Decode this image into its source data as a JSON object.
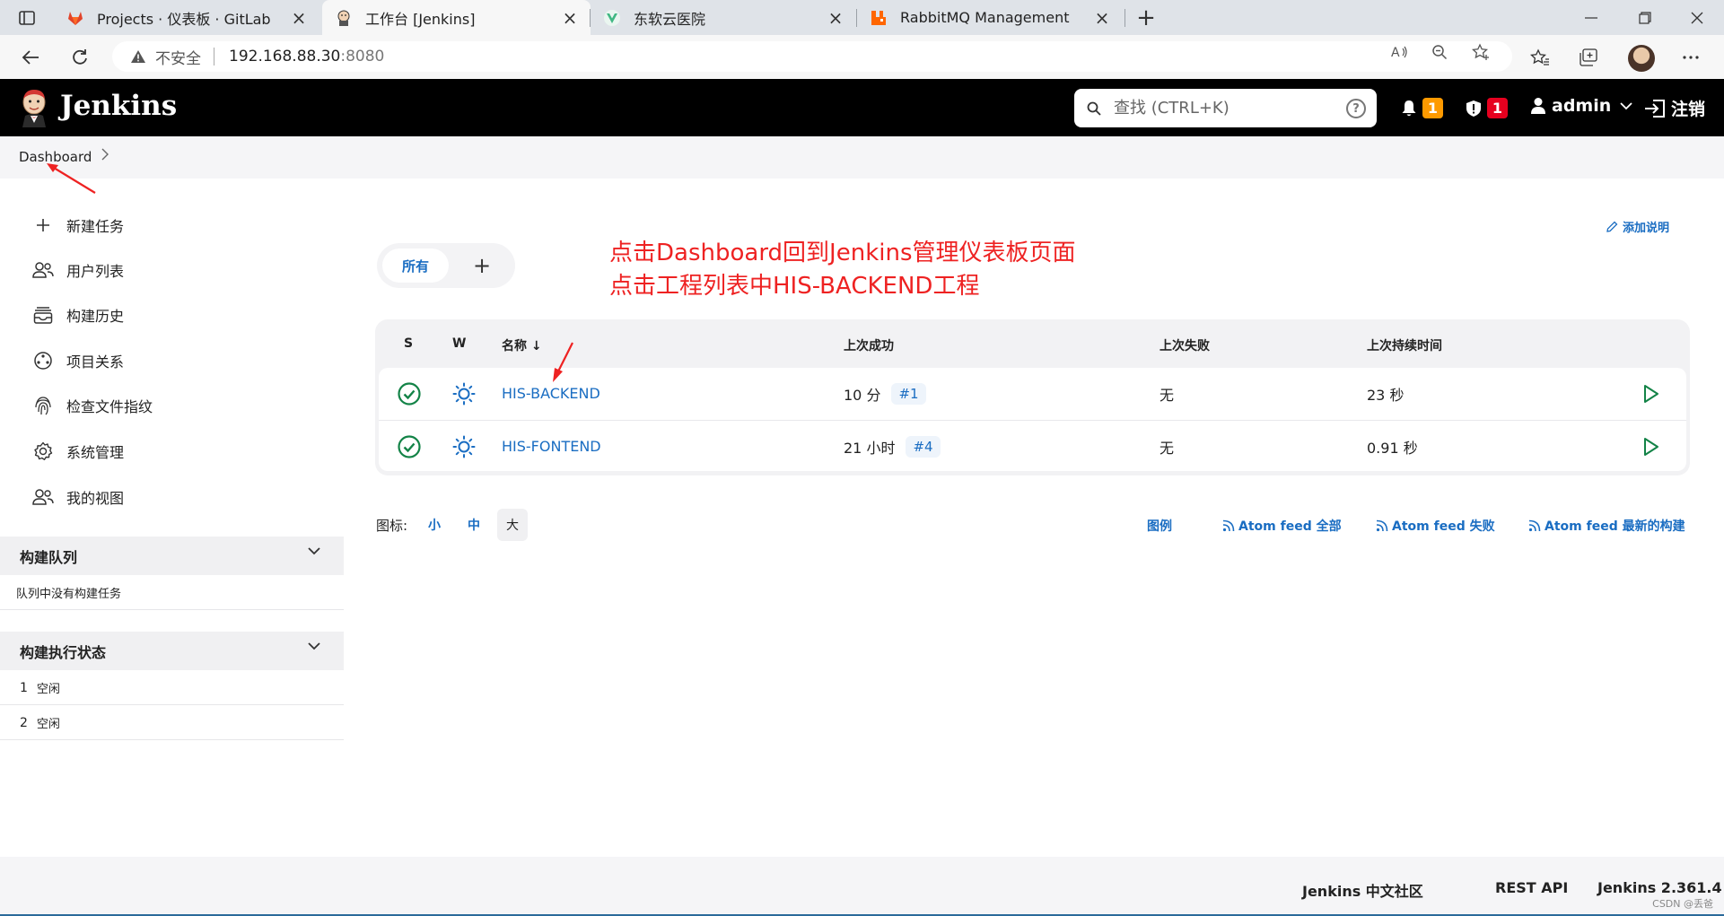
{
  "browser": {
    "tabs": [
      {
        "title": "Projects · 仪表板 · GitLab",
        "icon": "gitlab-icon",
        "active": false
      },
      {
        "title": "工作台 [Jenkins]",
        "icon": "jenkins-icon",
        "active": true
      },
      {
        "title": "东软云医院",
        "icon": "vue-icon",
        "active": false
      },
      {
        "title": "RabbitMQ Management",
        "icon": "rabbitmq-icon",
        "active": false
      }
    ],
    "address": {
      "security_label": "不安全",
      "host": "192.168.88.30",
      "port": ":8080"
    }
  },
  "jenkins": {
    "brand": "Jenkins",
    "search_placeholder": "查找 (CTRL+K)",
    "notifications_count": "1",
    "security_count": "1",
    "user": "admin",
    "logout": "注销"
  },
  "breadcrumb": {
    "items": [
      "Dashboard"
    ]
  },
  "sidebar": {
    "links": [
      {
        "label": "新建任务",
        "icon": "plus-icon"
      },
      {
        "label": "用户列表",
        "icon": "users-icon"
      },
      {
        "label": "构建历史",
        "icon": "build-history-icon"
      },
      {
        "label": "项目关系",
        "icon": "project-relationship-icon"
      },
      {
        "label": "检查文件指纹",
        "icon": "fingerprint-icon"
      },
      {
        "label": "系统管理",
        "icon": "gear-icon"
      },
      {
        "label": "我的视图",
        "icon": "my-views-icon"
      }
    ],
    "build_queue": {
      "title": "构建队列",
      "empty_text": "队列中没有构建任务"
    },
    "executors": {
      "title": "构建执行状态",
      "items": [
        {
          "num": "1",
          "status": "空闲"
        },
        {
          "num": "2",
          "status": "空闲"
        }
      ]
    }
  },
  "main": {
    "add_description": "添加说明",
    "view_tabs": {
      "all": "所有",
      "add": "+"
    },
    "annotation": {
      "line1": "点击Dashboard回到Jenkins管理仪表板页面",
      "line2": "点击工程列表中HIS-BACKEND工程"
    },
    "table": {
      "headers": {
        "status": "S",
        "weather": "W",
        "name": "名称 ↓",
        "last_success": "上次成功",
        "last_failure": "上次失败",
        "last_duration": "上次持续时间"
      },
      "rows": [
        {
          "name": "HIS-BACKEND",
          "last_success": "10 分",
          "last_success_build": "#1",
          "last_failure": "无",
          "last_duration": "23 秒"
        },
        {
          "name": "HIS-FONTEND",
          "last_success": "21 小时",
          "last_success_build": "#4",
          "last_failure": "无",
          "last_duration": "0.91 秒"
        }
      ]
    },
    "icon_size": {
      "label": "图标:",
      "small": "小",
      "medium": "中",
      "large": "大",
      "selected": "大"
    },
    "legend": "图例",
    "feeds": {
      "all": "Atom feed 全部",
      "failed": "Atom feed 失败",
      "latest": "Atom feed 最新的构建"
    }
  },
  "footer": {
    "community": "Jenkins 中文社区",
    "rest_api": "REST API",
    "version": "Jenkins 2.361.4",
    "watermark": "CSDN @丢爸"
  },
  "colors": {
    "link": "#1a6dc2",
    "success": "#138347",
    "badge_orange": "#fe9a00",
    "badge_red": "#e6001f",
    "annotation": "#ee2222"
  }
}
